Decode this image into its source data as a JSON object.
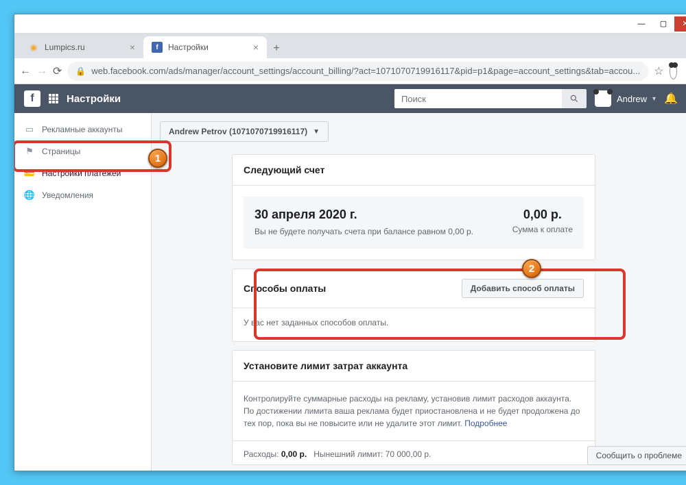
{
  "browser": {
    "tabs": [
      {
        "title": "Lumpics.ru",
        "active": false
      },
      {
        "title": "Настройки",
        "active": true
      }
    ],
    "url": "web.facebook.com/ads/manager/account_settings/account_billing/?act=1071070719916117&pid=p1&page=account_settings&tab=accou..."
  },
  "header": {
    "title": "Настройки",
    "search_placeholder": "Поиск",
    "username": "Andrew"
  },
  "sidebar": {
    "items": [
      {
        "label": "Рекламные аккаунты",
        "icon": "card"
      },
      {
        "label": "Страницы",
        "icon": "flag"
      },
      {
        "label": "Настройки платежей",
        "icon": "wallet",
        "selected": true
      },
      {
        "label": "Уведомления",
        "icon": "globe"
      }
    ]
  },
  "account_selector": {
    "label": "Andrew Petrov (1071070719916117)"
  },
  "next_bill": {
    "title": "Следующий счет",
    "date": "30 апреля 2020 г.",
    "description": "Вы не будете получать счета при балансе равном 0,00 р.",
    "amount": "0,00 р.",
    "amount_label": "Сумма к оплате"
  },
  "payment": {
    "title": "Способы оплаты",
    "add_button": "Добавить способ оплаты",
    "empty": "У вас нет заданных способов оплаты."
  },
  "limit": {
    "title": "Установите лимит затрат аккаунта",
    "description": "Контролируйте суммарные расходы на рекламу, установив лимит расходов аккаунта. По достижении лимита ваша реклама будет приостановлена и не будет продолжена до тех пор, пока вы не повысите или не удалите этот лимит.",
    "more": "Подробнее",
    "expense_label": "Расходы:",
    "expense_value": "0,00 р.",
    "current_label": "Нынешний лимит:",
    "current_value": "70 000,00 р."
  },
  "report_problem": "Сообщить о проблеме",
  "badges": {
    "one": "1",
    "two": "2"
  }
}
